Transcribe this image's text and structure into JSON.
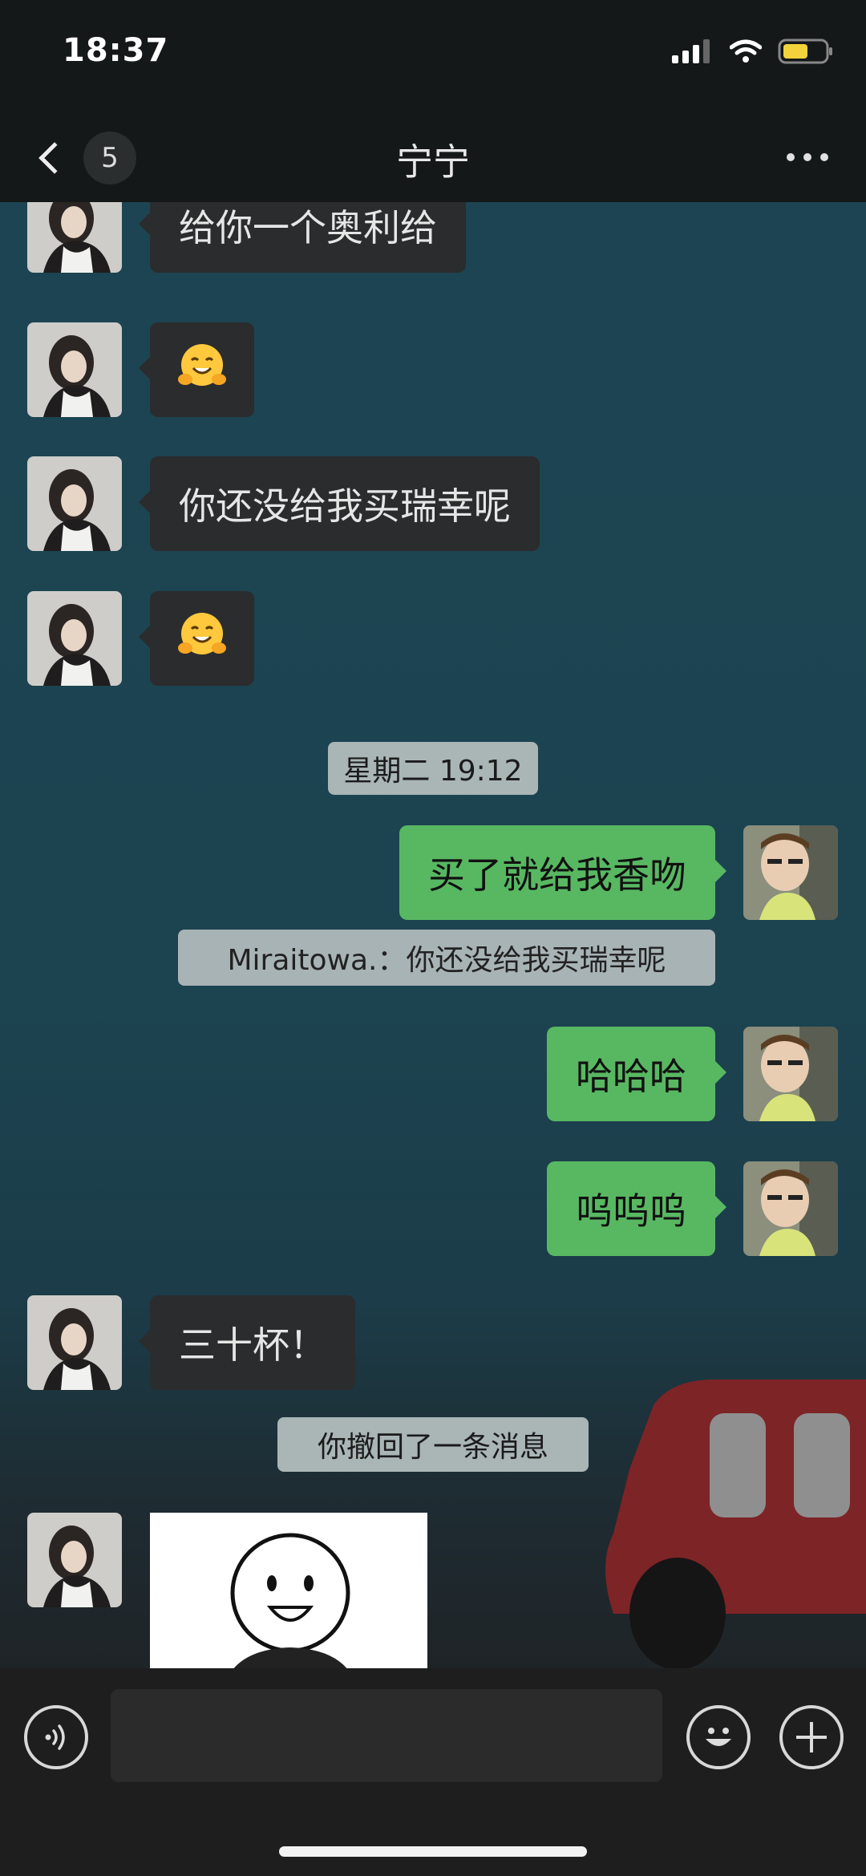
{
  "status_bar": {
    "time": "18:37"
  },
  "nav": {
    "unread_count": "5",
    "title": "宁宁"
  },
  "messages": [
    {
      "type": "text",
      "text": "给你一个奥利给"
    },
    {
      "type": "emoji",
      "text": "🤗"
    },
    {
      "type": "text",
      "text": "你还没给我买瑞幸呢"
    },
    {
      "type": "emoji",
      "text": "🤗"
    },
    {
      "type": "time",
      "text": "星期二 19:12"
    },
    {
      "type": "text",
      "text": "买了就给我香吻"
    },
    {
      "type": "quote",
      "text": "Miraitowa.：你还没给我买瑞幸呢"
    },
    {
      "type": "text",
      "text": "哈哈哈"
    },
    {
      "type": "text",
      "text": "呜呜呜"
    },
    {
      "type": "text",
      "text": "三十杯！"
    },
    {
      "type": "system",
      "text": "你撤回了一条消息"
    },
    {
      "type": "sticker"
    }
  ],
  "input_bar": {
    "message_value": ""
  },
  "colors": {
    "incoming_bubble": "#2b2c2d",
    "outgoing_bubble": "#58b862",
    "chat_bg": "#1d4452"
  }
}
